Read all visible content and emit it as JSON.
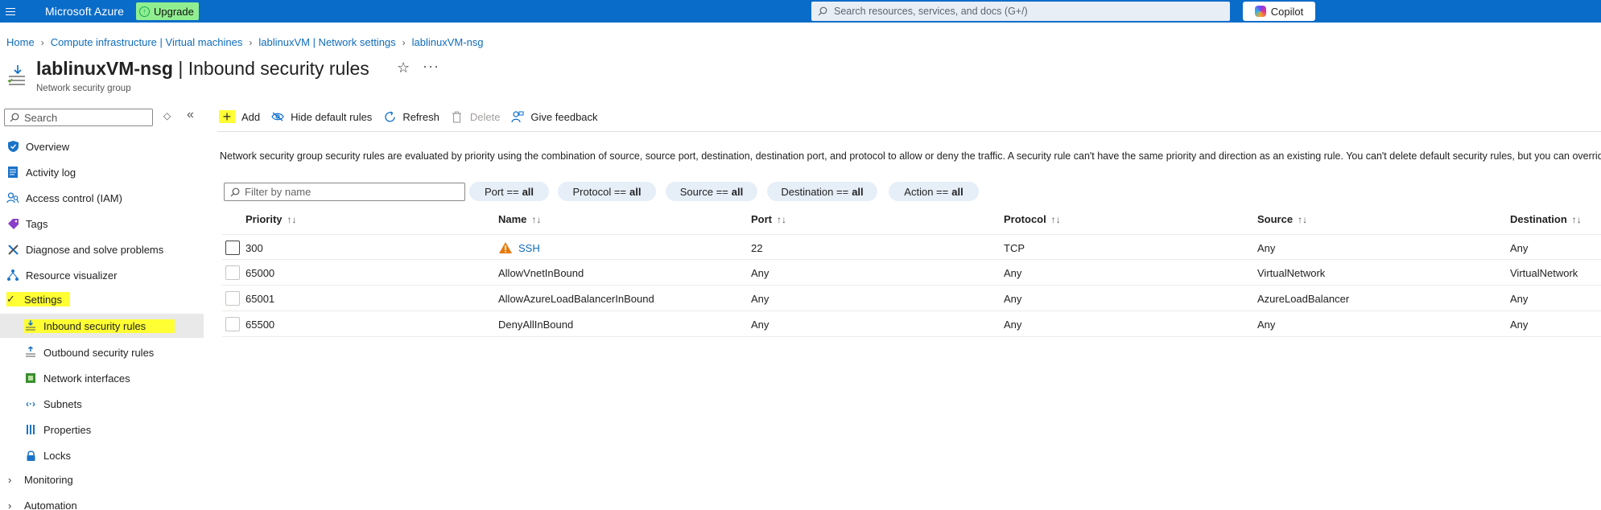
{
  "topbar": {
    "brand": "Microsoft Azure",
    "upgrade_label": "Upgrade",
    "search_placeholder": "Search resources, services, and docs (G+/)",
    "copilot_label": "Copilot"
  },
  "breadcrumb": [
    "Home",
    "Compute infrastructure | Virtual machines",
    "lablinuxVM | Network settings",
    "lablinuxVM-nsg"
  ],
  "header": {
    "resource_name": "lablinuxVM-nsg",
    "separator": " | ",
    "page_name": "Inbound security rules",
    "subtitle": "Network security group"
  },
  "sidebar": {
    "search_placeholder": "Search",
    "items": [
      {
        "label": "Overview"
      },
      {
        "label": "Activity log"
      },
      {
        "label": "Access control (IAM)"
      },
      {
        "label": "Tags"
      },
      {
        "label": "Diagnose and solve problems"
      },
      {
        "label": "Resource visualizer"
      },
      {
        "label": "Settings"
      },
      {
        "label": "Inbound security rules"
      },
      {
        "label": "Outbound security rules"
      },
      {
        "label": "Network interfaces"
      },
      {
        "label": "Subnets"
      },
      {
        "label": "Properties"
      },
      {
        "label": "Locks"
      },
      {
        "label": "Monitoring"
      },
      {
        "label": "Automation"
      }
    ]
  },
  "toolbar": {
    "add": "Add",
    "hide_default": "Hide default rules",
    "refresh": "Refresh",
    "delete": "Delete",
    "feedback": "Give feedback"
  },
  "description": "Network security group security rules are evaluated by priority using the combination of source, source port, destination, destination port, and protocol to allow or deny the traffic. A security rule can't have the same priority and direction as an existing rule. You can't delete default security rules, but you can override them with rules that have a higher priority.",
  "filters": {
    "placeholder": "Filter by name",
    "pills": [
      {
        "key": "Port ==",
        "value": "all"
      },
      {
        "key": "Protocol ==",
        "value": "all"
      },
      {
        "key": "Source ==",
        "value": "all"
      },
      {
        "key": "Destination ==",
        "value": "all"
      },
      {
        "key": "Action ==",
        "value": "all"
      }
    ]
  },
  "table": {
    "columns": [
      "Priority",
      "Name",
      "Port",
      "Protocol",
      "Source",
      "Destination"
    ],
    "rows": [
      {
        "priority": "300",
        "name": "SSH",
        "port": "22",
        "protocol": "TCP",
        "source": "Any",
        "destination": "Any"
      },
      {
        "priority": "65000",
        "name": "AllowVnetInBound",
        "port": "Any",
        "protocol": "Any",
        "source": "VirtualNetwork",
        "destination": "VirtualNetwork"
      },
      {
        "priority": "65001",
        "name": "AllowAzureLoadBalancerInBound",
        "port": "Any",
        "protocol": "Any",
        "source": "AzureLoadBalancer",
        "destination": "Any"
      },
      {
        "priority": "65500",
        "name": "DenyAllInBound",
        "port": "Any",
        "protocol": "Any",
        "source": "Any",
        "destination": "Any"
      }
    ]
  },
  "colors": {
    "azure_blue": "#0a6cc9",
    "link": "#0f6cbd",
    "highlight": "#ffff33",
    "warning": "#e8790e"
  }
}
